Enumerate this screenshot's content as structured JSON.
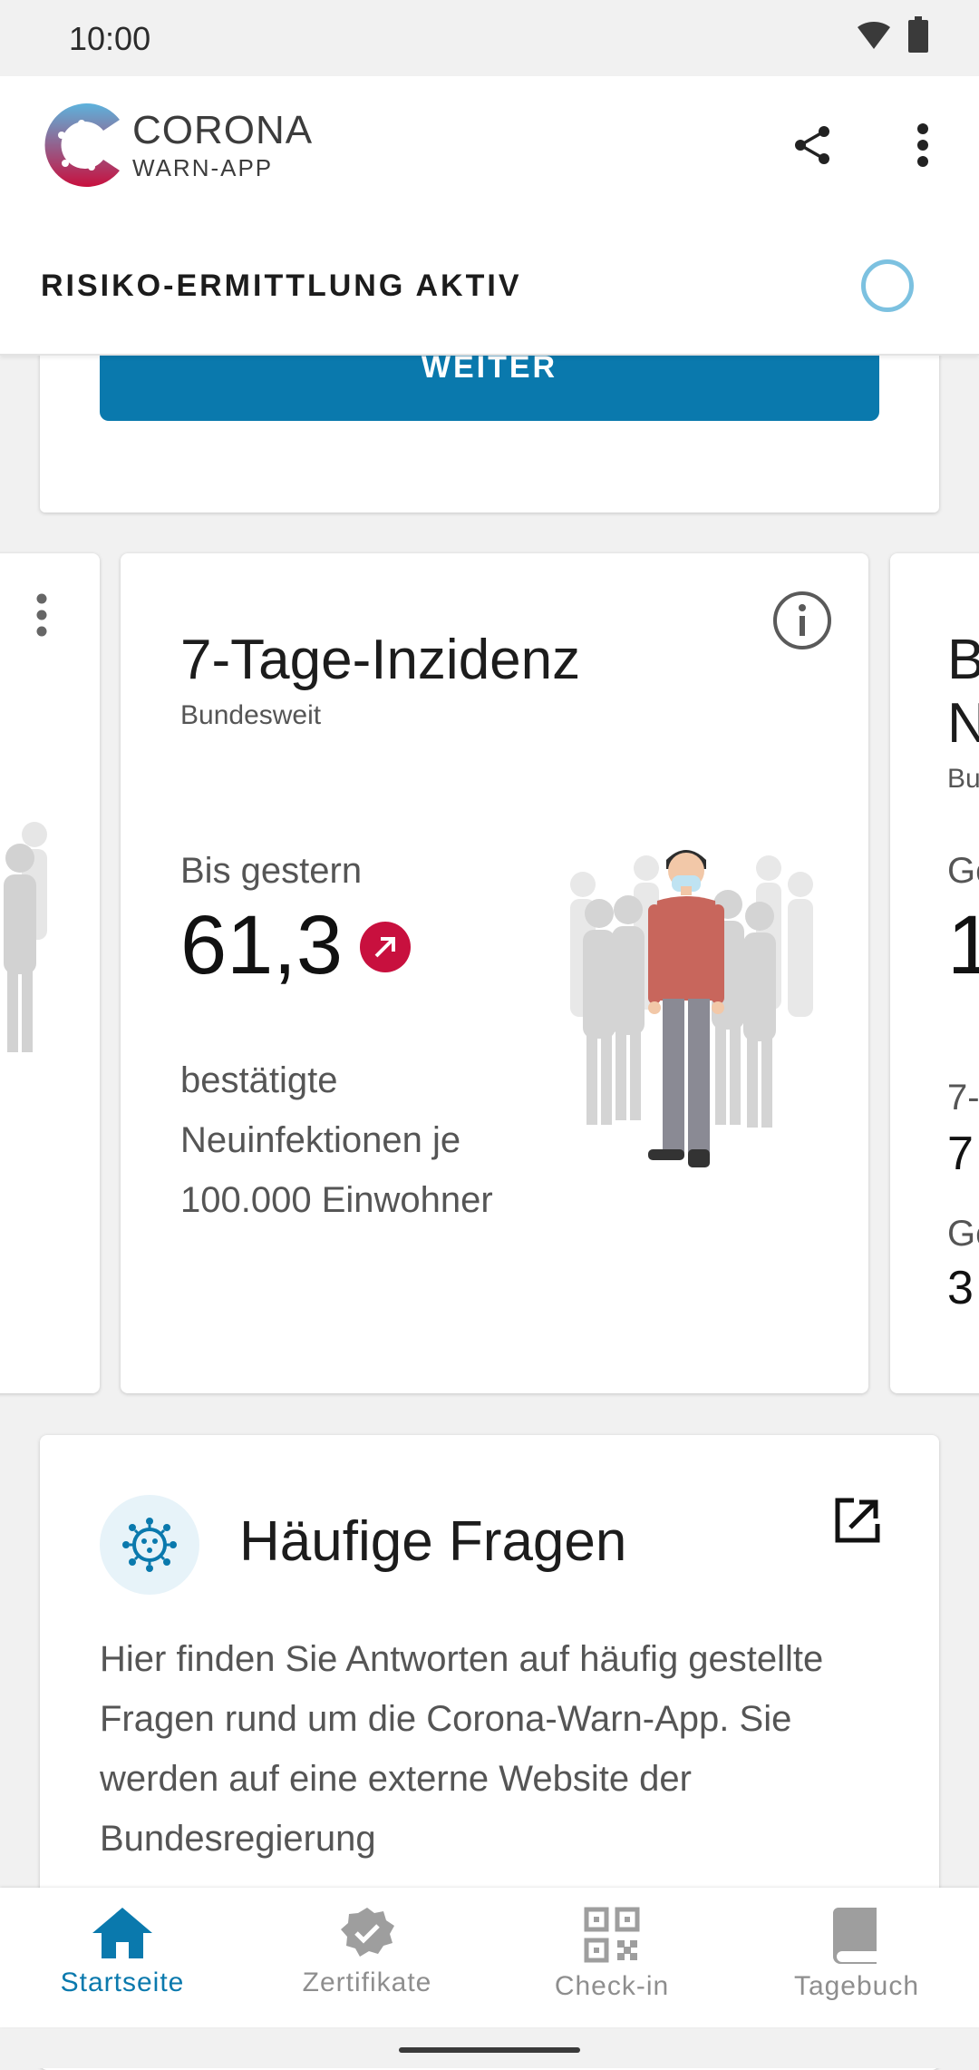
{
  "status_bar": {
    "time": "10:00"
  },
  "app_bar": {
    "logo_title": "CORONA",
    "logo_subtitle": "WARN-APP"
  },
  "risk": {
    "status_label": "RISIKO-ERMITTLUNG AKTIV"
  },
  "top_card": {
    "button_label": "WEITER"
  },
  "incidence_card": {
    "title": "7-Tage-Inzidenz",
    "subtitle": "Bundesweit",
    "label": "Bis gestern",
    "value": "61,3",
    "description": "bestätigte Neuinfektionen je 100.000 Einwohner"
  },
  "next_card_fragments": [
    "B",
    "N",
    "Bu",
    "Ge",
    "1",
    "7-",
    "7",
    "Ge",
    "3"
  ],
  "faq": {
    "title": "Häufige Fragen",
    "text": "Hier finden Sie Antworten auf häufig gestellte Fragen rund um die Corona-Warn-App. Sie werden auf eine externe Website der Bundesregierung"
  },
  "bottom_nav": {
    "items": [
      {
        "label": "Startseite",
        "icon": "home-icon",
        "active": true
      },
      {
        "label": "Zertifikate",
        "icon": "certificate-icon",
        "active": false
      },
      {
        "label": "Check-in",
        "icon": "qr-code-icon",
        "active": false
      },
      {
        "label": "Tagebuch",
        "icon": "diary-icon",
        "active": false
      }
    ]
  },
  "colors": {
    "accent": "#0a79ad",
    "trend_red": "#c8103e",
    "risk_indicator": "#7cc1e0",
    "inactive_nav": "#8e8e8e"
  }
}
